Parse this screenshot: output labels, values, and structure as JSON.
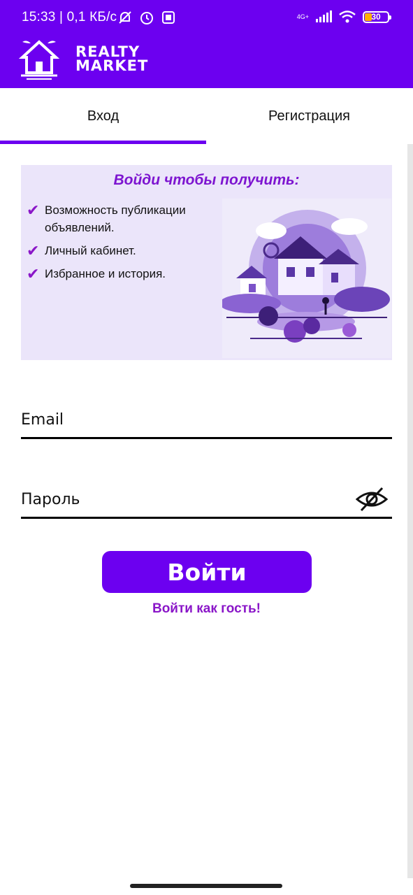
{
  "status_bar": {
    "time": "15:33 | 0,1 КБ/с",
    "network": "4G+",
    "battery": "30",
    "icons": [
      "mute-notifications-icon",
      "alarm-icon",
      "screen-record-icon",
      "signal-icon",
      "wifi-icon",
      "battery-icon"
    ]
  },
  "app": {
    "logo_line1": "REALTY",
    "logo_line2": "MARKET"
  },
  "tabs": [
    {
      "label": "Вход",
      "active": true
    },
    {
      "label": "Регистрация",
      "active": false
    }
  ],
  "promo": {
    "title": "Войди чтобы получить:",
    "items": [
      "Возможность публикации объявлений.",
      "Личный кабинет.",
      "Избранное и история."
    ]
  },
  "form": {
    "email_placeholder": "Email",
    "password_placeholder": "Пароль",
    "login_label": "Войти",
    "guest_label": "Войти как гость!"
  },
  "colors": {
    "primary": "#6c00f0",
    "accent": "#8a16c8",
    "promo_bg": "#ebe5fa"
  }
}
